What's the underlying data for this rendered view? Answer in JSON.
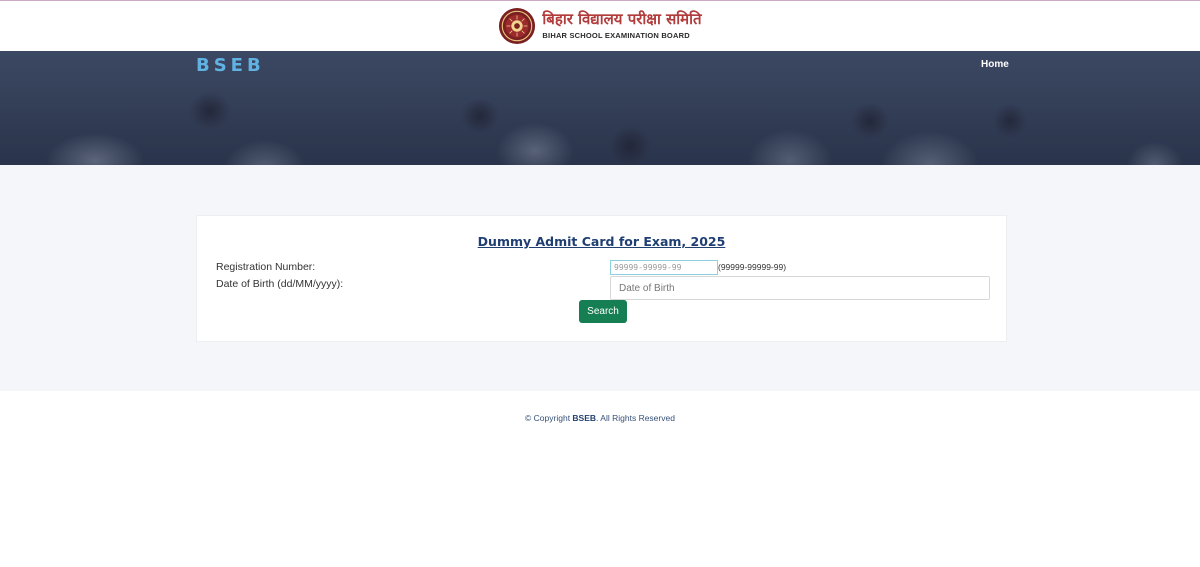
{
  "header": {
    "hindi_title": "बिहार विद्यालय परीक्षा समिति",
    "english_title": "BIHAR SCHOOL EXAMINATION BOARD",
    "brand": "BSEB",
    "nav": {
      "home": "Home"
    },
    "brand_color": "#5fb2e2"
  },
  "card": {
    "title": "Dummy Admit Card for Exam, 2025",
    "registration_label": "Registration Number:",
    "registration_placeholder": "99999-99999-99",
    "registration_value": "",
    "registration_hint": "(99999-99999-99)",
    "dob_label": "Date of Birth (dd/MM/yyyy):",
    "dob_placeholder": "Date of Birth",
    "dob_value": "",
    "search_label": "Search",
    "search_color": "#157f53"
  },
  "footer": {
    "copyright_prefix": "© Copyright ",
    "copyright_brand": "BSEB",
    "copyright_suffix": ". All Rights Reserved"
  },
  "icons": {
    "emblem": "bseb-emblem-icon"
  }
}
